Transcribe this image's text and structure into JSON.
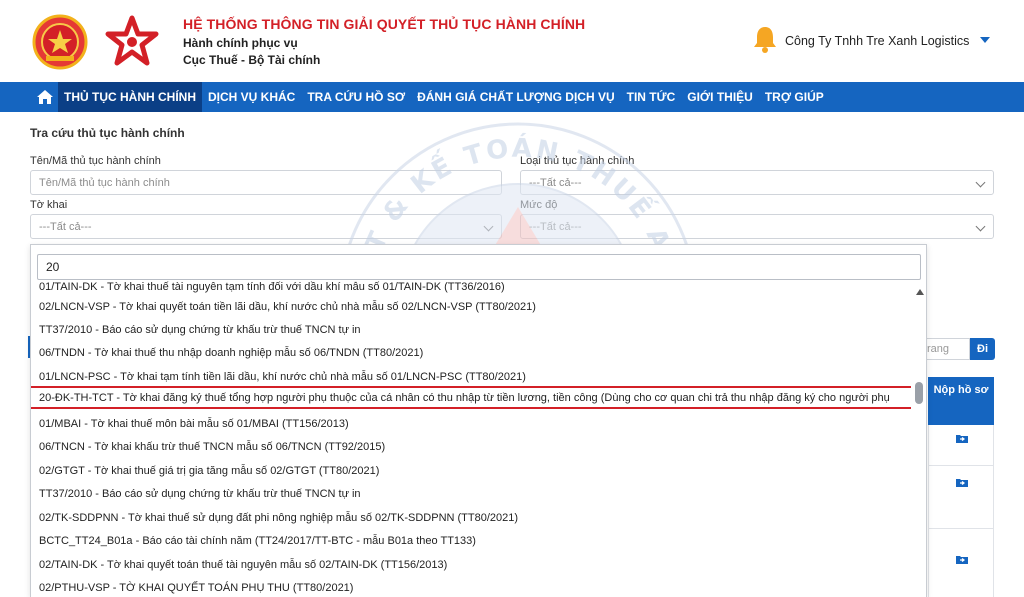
{
  "header": {
    "system_title": "HỆ THỐNG THÔNG TIN GIẢI QUYẾT THỦ TỤC HÀNH CHÍNH",
    "subtitle1": "Hành chính phục vụ",
    "subtitle2": "Cục Thuế - Bộ Tài chính",
    "company": "Công Ty Tnhh Tre Xanh Logistics",
    "brand_red": "#d32027",
    "brand_blue": "#1565c0"
  },
  "nav": {
    "home_icon": "home-icon",
    "items": [
      "THỦ TỤC HÀNH CHÍNH",
      "DỊCH VỤ KHÁC",
      "TRA CỨU HỒ SƠ",
      "ĐÁNH GIÁ CHẤT LƯỢNG DỊCH VỤ",
      "TIN TỨC",
      "GIỚI THIỆU",
      "TRỢ GIÚP"
    ],
    "active_index": 0
  },
  "search": {
    "title": "Tra cứu thủ tục hành chính",
    "name_label": "Tên/Mã thủ tục hành chính",
    "name_placeholder": "Tên/Mã thủ tục hành chính",
    "type_label": "Loại thủ tục hành chính",
    "type_value": "---Tất cả---",
    "form_label": "Tờ khai",
    "form_value": "---Tất cả---",
    "level_label": "Mức độ",
    "level_value": "---Tất cả---"
  },
  "dropdown": {
    "query": "20",
    "items": [
      "01/TAIN-DK - Tờ khai thuế tài nguyên tạm tính đối với dầu khí mẫu số 01/TAIN-DK (TT36/2016)",
      "02/LNCN-VSP - Tờ khai quyết toán tiền lãi dầu, khí nước chủ nhà mẫu số 02/LNCN-VSP (TT80/2021)",
      "TT37/2010 - Báo cáo sử dụng chứng từ khấu trừ thuế TNCN tự in",
      "06/TNDN - Tờ khai thuế thu nhập doanh nghiệp mẫu số 06/TNDN (TT80/2021)",
      "01/LNCN-PSC - Tờ khai tạm tính tiền lãi dầu, khí nước chủ nhà mẫu số 01/LNCN-PSC (TT80/2021)",
      "20-ĐK-TH-TCT - Tờ khai đăng ký thuế tổng hợp người phụ thuộc của cá nhân có thu nhập từ tiền lương, tiền công (Dùng cho cơ quan chi trả thu nhập đăng ký cho người phụ",
      "01/MBAI - Tờ khai thuế môn bài mẫu số 01/MBAI (TT156/2013)",
      "06/TNCN - Tờ khai khấu trừ thuế TNCN mẫu số 06/TNCN (TT92/2015)",
      "02/GTGT - Tờ khai thuế giá trị gia tăng mẫu số 02/GTGT (TT80/2021)",
      "TT37/2010 - Báo cáo sử dụng chứng từ khấu trừ thuế TNCN tự in",
      "02/TK-SDDPNN - Tờ khai thuế sử dụng đất phi nông nghiệp mẫu số 02/TK-SDDPNN (TT80/2021)",
      "BCTC_TT24_B01a - Báo cáo tài chính năm (TT24/2017/TT-BTC - mẫu B01a theo TT133)",
      "02/TAIN-DK - Tờ khai quyết toán thuế tài nguyên mẫu số 02/TAIN-DK (TT156/2013)",
      "02/PTHU-VSP - TỜ KHAI QUYẾT TOÁN PHỤ THU (TT80/2021)"
    ],
    "highlight_index": 5
  },
  "table": {
    "go_placeholder": "rang",
    "go_label": "Đi",
    "submit_column": "Nộp hồ sơ"
  },
  "watermark": {
    "top_text": "LUẬT & KẾ TOÁN THUẾ APEC",
    "center_text": "APECTAX",
    "bottom_text": "TAX LAW & ACCOUNTING"
  }
}
